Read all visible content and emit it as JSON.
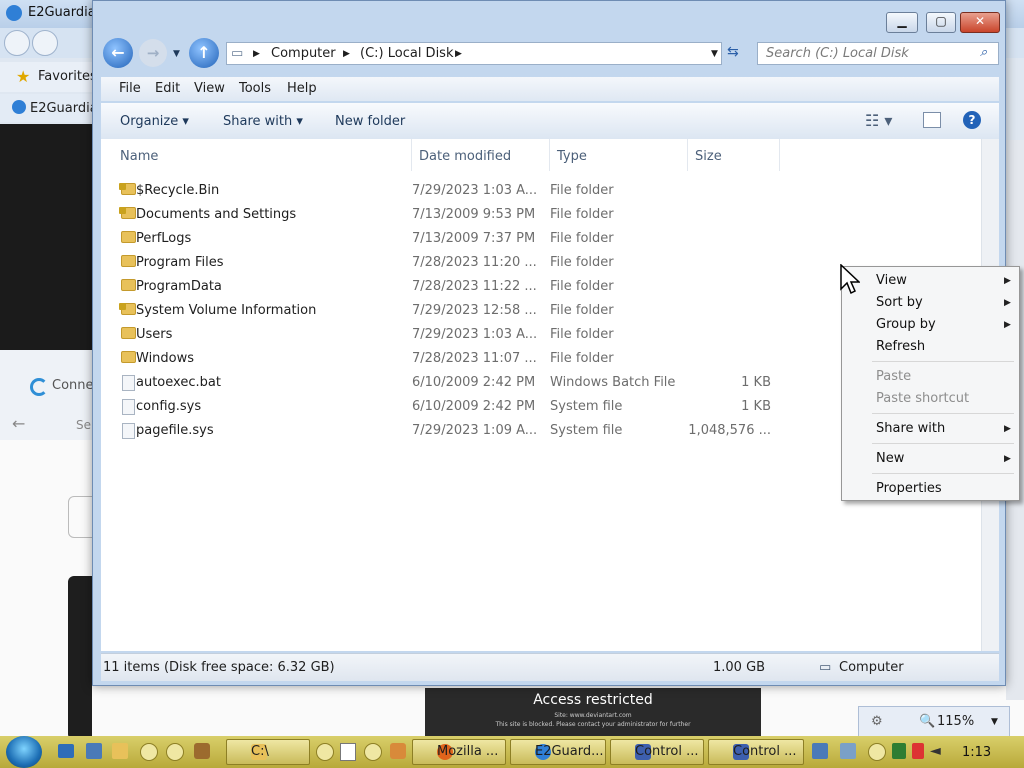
{
  "background_window": {
    "title": "E2Guardia",
    "favorites_label": "Favorites",
    "tab_label": "E2Guardia",
    "connecting_label": "Conne",
    "search_stub": "Se",
    "access_title": "Access restricted",
    "access_site": "Site: www.deviantart.com",
    "access_note": "This site is blocked. Please contact your administrator for further",
    "zoom_level": "115%"
  },
  "explorer": {
    "address": {
      "root": "Computer",
      "drive": "(C:) Local Disk"
    },
    "search_placeholder": "Search (C:) Local Disk",
    "menu": [
      "File",
      "Edit",
      "View",
      "Tools",
      "Help"
    ],
    "toolbar": {
      "organize": "Organize",
      "share_with": "Share with",
      "new_folder": "New folder"
    },
    "columns": [
      "Name",
      "Date modified",
      "Type",
      "Size"
    ],
    "rows": [
      {
        "name": "$Recycle.Bin",
        "date": "7/29/2023 1:03 A...",
        "type": "File folder",
        "size": "",
        "icon": "locked-folder-icon"
      },
      {
        "name": "Documents and Settings",
        "date": "7/13/2009 9:53 PM",
        "type": "File folder",
        "size": "",
        "icon": "locked-folder-icon"
      },
      {
        "name": "PerfLogs",
        "date": "7/13/2009 7:37 PM",
        "type": "File folder",
        "size": "",
        "icon": "folder-icon"
      },
      {
        "name": "Program Files",
        "date": "7/28/2023 11:20 ...",
        "type": "File folder",
        "size": "",
        "icon": "folder-icon"
      },
      {
        "name": "ProgramData",
        "date": "7/28/2023 11:22 ...",
        "type": "File folder",
        "size": "",
        "icon": "folder-icon"
      },
      {
        "name": "System Volume Information",
        "date": "7/29/2023 12:58 ...",
        "type": "File folder",
        "size": "",
        "icon": "locked-folder-icon"
      },
      {
        "name": "Users",
        "date": "7/29/2023 1:03 A...",
        "type": "File folder",
        "size": "",
        "icon": "folder-icon"
      },
      {
        "name": "Windows",
        "date": "7/28/2023 11:07 ...",
        "type": "File folder",
        "size": "",
        "icon": "folder-icon"
      },
      {
        "name": "autoexec.bat",
        "date": "6/10/2009 2:42 PM",
        "type": "Windows Batch File",
        "size": "1 KB",
        "icon": "file-icon"
      },
      {
        "name": "config.sys",
        "date": "6/10/2009 2:42 PM",
        "type": "System file",
        "size": "1 KB",
        "icon": "file-icon"
      },
      {
        "name": "pagefile.sys",
        "date": "7/29/2023 1:09 A...",
        "type": "System file",
        "size": "1,048,576 ...",
        "icon": "file-icon"
      }
    ],
    "status": {
      "items": "11 items (Disk free space: 6.32 GB)",
      "size": "1.00 GB",
      "location": "Computer"
    }
  },
  "context_menu": {
    "view": "View",
    "sort_by": "Sort by",
    "group_by": "Group by",
    "refresh": "Refresh",
    "paste": "Paste",
    "paste_shortcut": "Paste shortcut",
    "share_with": "Share with",
    "new": "New",
    "properties": "Properties"
  },
  "taskbar": {
    "items": [
      "C:\\",
      "Mozilla ...",
      "E2Guard...",
      "Control ...",
      "Control ..."
    ],
    "clock": "1:13"
  },
  "colors": {
    "accent": "#1e395b",
    "taskbar": "#c9bb5a",
    "folder": "#e8c15a"
  }
}
